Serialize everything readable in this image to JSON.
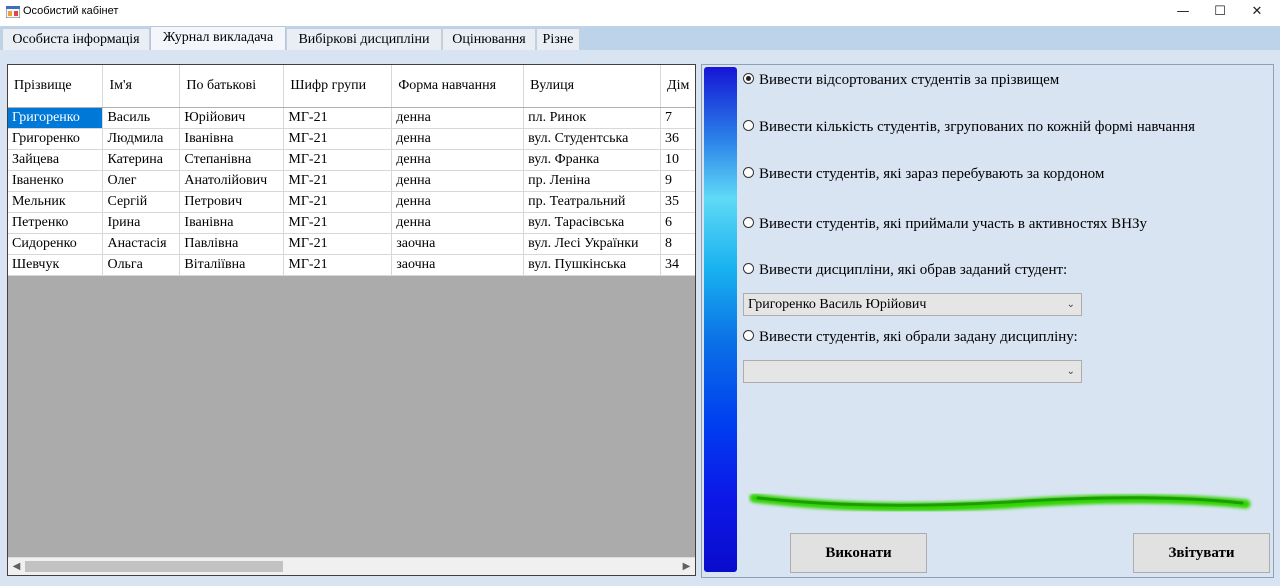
{
  "window": {
    "title": "Особистий кабінет",
    "minimize": "—",
    "maximize": "☐",
    "close": "✕"
  },
  "tabs": [
    "Особиста інформація",
    "Журнал викладача",
    "Вибіркові дисципліни",
    "Оцінювання",
    "Різне"
  ],
  "active_tab": "Журнал викладача",
  "grid": {
    "columns": [
      "Прізвище",
      "Ім'я",
      "По батькові",
      "Шифр групи",
      "Форма навчання",
      "Вулиця",
      "Дім"
    ],
    "rows": [
      [
        "Григоренко",
        "Василь",
        "Юрійович",
        "МГ-21",
        "денна",
        "пл. Ринок",
        "7"
      ],
      [
        "Григоренко",
        "Людмила",
        "Іванівна",
        "МГ-21",
        "денна",
        "вул. Студентська",
        "36"
      ],
      [
        "Зайцева",
        "Катерина",
        "Степанівна",
        "МГ-21",
        "денна",
        "вул. Франка",
        "10"
      ],
      [
        "Іваненко",
        "Олег",
        "Анатолійович",
        "МГ-21",
        "денна",
        "пр. Леніна",
        "9"
      ],
      [
        "Мельник",
        "Сергій",
        "Петрович",
        "МГ-21",
        "денна",
        "пр. Театральний",
        "35"
      ],
      [
        "Петренко",
        "Ірина",
        "Іванівна",
        "МГ-21",
        "денна",
        "вул. Тарасівська",
        "6"
      ],
      [
        "Сидоренко",
        "Анастасія",
        "Павлівна",
        "МГ-21",
        "заочна",
        "вул. Лесі Українки",
        "8"
      ],
      [
        "Шевчук",
        "Ольга",
        "Віталіївна",
        "МГ-21",
        "заочна",
        "вул. Пушкінська",
        "34"
      ]
    ],
    "selected_cell": "Григоренко"
  },
  "options": {
    "sorted": "Вивести відсортованих студентів за прізвищем",
    "count_by_form": "Вивести кількість студентів, згрупованих по кожній формі навчання",
    "abroad": "Вивести студентів, які зараз перебувають за кордоном",
    "activities": "Вивести студентів, які приймали участь в активностях ВНЗу",
    "disciplines_of_student": "Вивести дисципліни, які обрав заданий студент:",
    "students_of_discipline": "Вивести студентів, які обрали задану дисципліну:"
  },
  "selected_option": "sorted",
  "student_combo": {
    "value": "Григоренко Василь Юрійович"
  },
  "discipline_combo": {
    "value": ""
  },
  "buttons": {
    "execute": "Виконати",
    "report": "Звітувати"
  },
  "colors": {
    "selection": "#0078d7",
    "panel_bg": "#d8e4f2",
    "tabstrip_bg": "#bdd3ea",
    "accent_green": "#2fd400"
  }
}
